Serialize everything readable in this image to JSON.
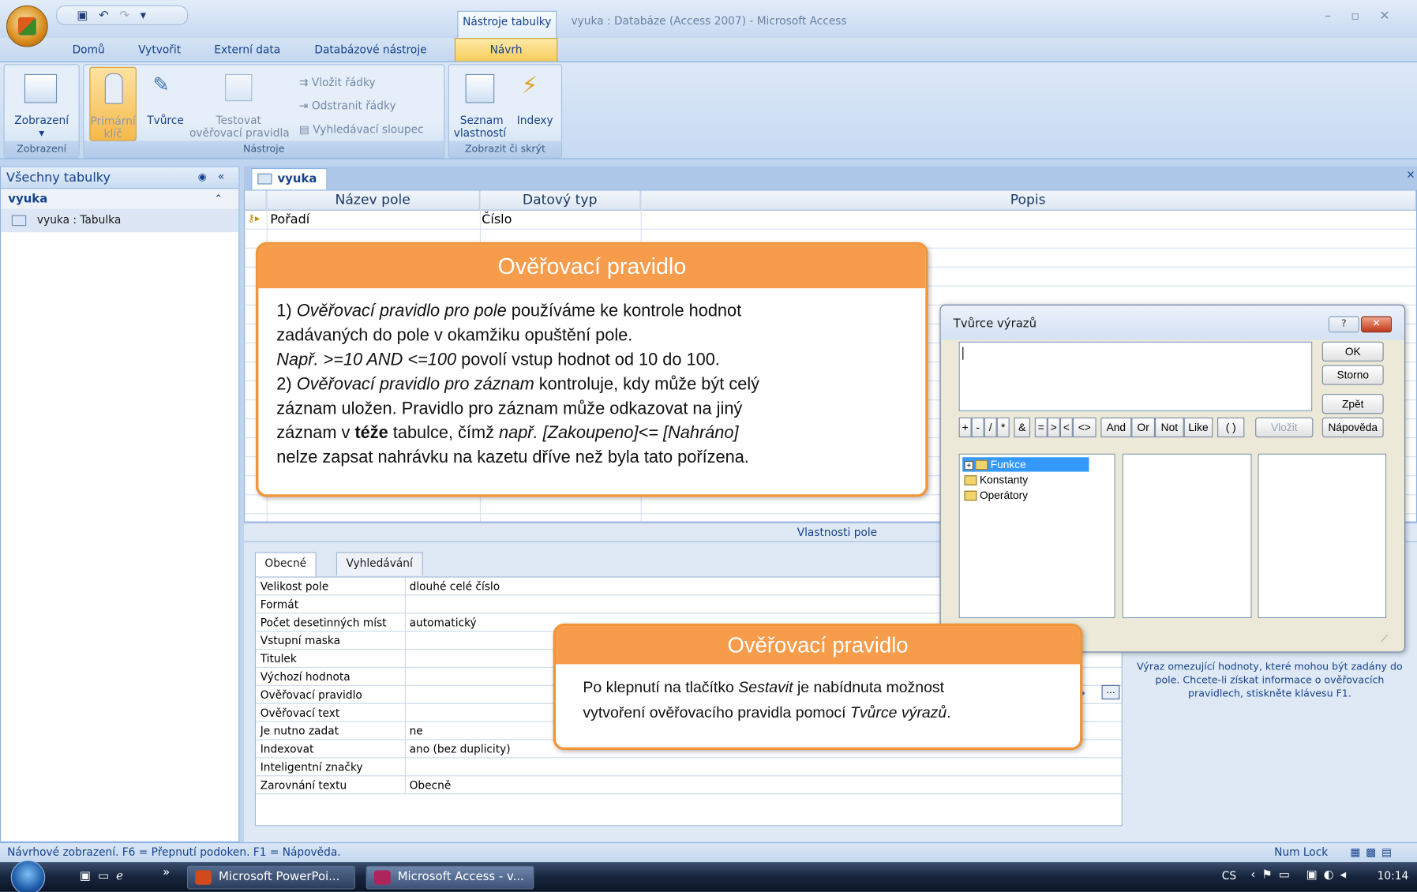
{
  "titlebar": {
    "context_tab": "Nástroje tabulky",
    "window_title": "vyuka : Databáze (Access 2007) - Microsoft Access",
    "qat_icons": [
      "save-icon",
      "undo-icon",
      "redo-icon",
      "customize-icon"
    ]
  },
  "ribbon_tabs": [
    "Domů",
    "Vytvořit",
    "Externí data",
    "Databázové nástroje",
    "Návrh"
  ],
  "ribbon": {
    "zobrazeni": {
      "button": "Zobrazení",
      "group": "Zobrazení"
    },
    "nastroje": {
      "primarni_line1": "Primární",
      "primarni_line2": "klíč",
      "tvurce": "Tvůrce",
      "testovat_line1": "Testovat",
      "testovat_line2": "ověřovací pravidla",
      "vlozit": "Vložit řádky",
      "odstranit": "Odstranit řádky",
      "vyhledavaci": "Vyhledávací sloupec",
      "group": "Nástroje"
    },
    "zobrazit": {
      "seznam_line1": "Seznam",
      "seznam_line2": "vlastností",
      "indexy": "Indexy",
      "group": "Zobrazit či skrýt"
    }
  },
  "nav": {
    "header": "Všechny tabulky",
    "group": "vyuka",
    "item": "vyuka : Tabulka"
  },
  "doc": {
    "tab": "vyuka",
    "columns": [
      "Název pole",
      "Datový typ",
      "Popis"
    ],
    "rows": [
      {
        "name": "Pořadí",
        "type": "Číslo",
        "desc": ""
      }
    ],
    "props_title": "Vlastnosti pole"
  },
  "props": {
    "tabs": [
      "Obecné",
      "Vyhledávání"
    ],
    "rows": [
      {
        "label": "Velikost pole",
        "value": "dlouhé celé číslo"
      },
      {
        "label": "Formát",
        "value": ""
      },
      {
        "label": "Počet desetinných míst",
        "value": "automatický"
      },
      {
        "label": "Vstupní maska",
        "value": ""
      },
      {
        "label": "Titulek",
        "value": ""
      },
      {
        "label": "Výchozí hodnota",
        "value": ""
      },
      {
        "label": "Ověřovací pravidlo",
        "value": ""
      },
      {
        "label": "Ověřovací text",
        "value": ""
      },
      {
        "label": "Je nutno zadat",
        "value": "ne"
      },
      {
        "label": "Indexovat",
        "value": "ano (bez duplicity)"
      },
      {
        "label": "Inteligentní značky",
        "value": ""
      },
      {
        "label": "Zarovnání textu",
        "value": "Obecně"
      }
    ],
    "help": "Výraz omezující hodnoty, které mohou být zadány do pole. Chcete-li získat informace o ověřovacích pravidlech, stiskněte klávesu F1."
  },
  "status": {
    "left": "Návrhové zobrazení.  F6 = Přepnutí podoken.  F1 = Nápověda.",
    "numlock": "Num Lock"
  },
  "taskbar": {
    "items": [
      "Microsoft PowerPoi...",
      "Microsoft Access - v..."
    ],
    "lang": "CS",
    "clock": "10:14"
  },
  "callout1": {
    "title": "Ověřovací pravidlo",
    "l1a": "1) ",
    "l1b": "Ověřovací pravidlo pro pole",
    "l1c": " používáme ke kontrole hodnot",
    "l2": "zadávaných do pole v okamžiku opuštění pole.",
    "l3a": "Např. >=10 AND <=100",
    "l3b": " povolí vstup hodnot od 10  do 100.",
    "l4a": "2) ",
    "l4b": "Ověřovací pravidlo pro záznam",
    "l4c": " kontroluje, kdy může být celý",
    "l5": "záznam uložen. Pravidlo pro záznam může odkazovat na jiný",
    "l6a": "záznam v ",
    "l6b": "téže",
    "l6c": " tabulce, čímž ",
    "l6d": "např. [Zakoupeno]<= [Nahráno]",
    "l7": "nelze zapsat nahrávku na kazetu dříve než byla tato pořízena."
  },
  "callout2": {
    "title": "Ověřovací pravidlo",
    "l1a": "Po klepnutí na tlačítko ",
    "l1b": "Sestavit",
    "l1c": " je nabídnuta možnost",
    "l2a": "vytvoření ověřovacího pravidla pomocí ",
    "l2b": "Tvůrce výrazů",
    "l2c": "."
  },
  "dialog": {
    "title": "Tvůrce výrazů",
    "ok": "OK",
    "storno": "Storno",
    "zpet": "Zpět",
    "napoveda": "Nápověda",
    "vlozit": "Vložit",
    "help_btn": "?",
    "ops": [
      "+",
      "-",
      "/",
      "*",
      "&",
      "=",
      ">",
      "<",
      "<>",
      "And",
      "Or",
      "Not",
      "Like",
      "( )"
    ],
    "tree": [
      "Funkce",
      "Konstanty",
      "Operátory"
    ]
  }
}
